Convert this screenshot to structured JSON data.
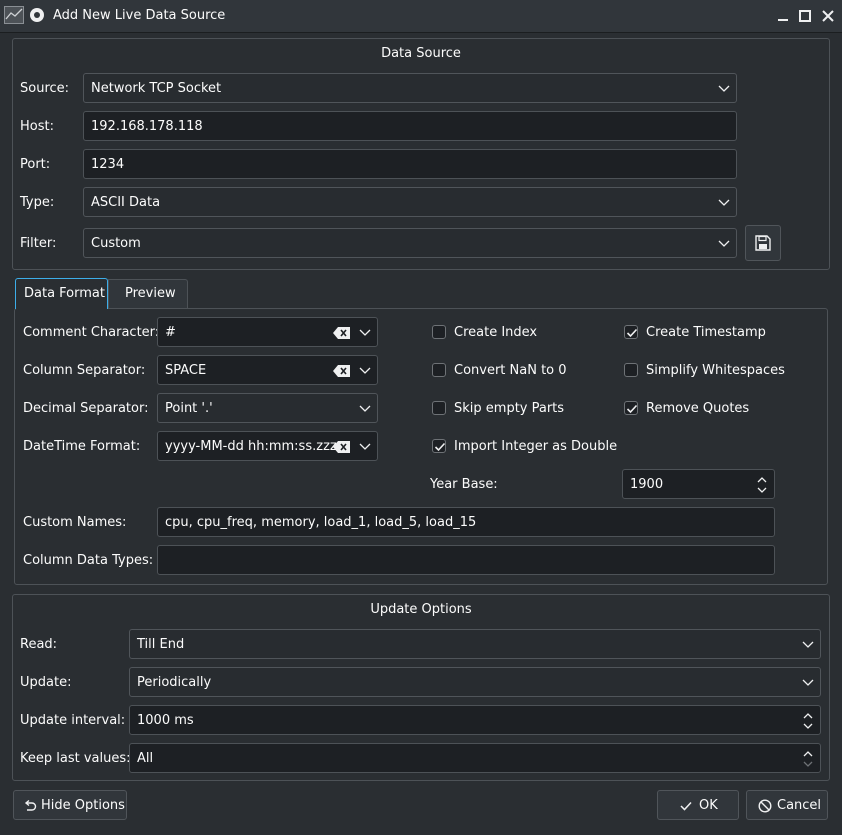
{
  "window": {
    "title": "Add New Live Data Source"
  },
  "data_source": {
    "title": "Data Source",
    "source": {
      "label": "Source:",
      "value": "Network TCP Socket"
    },
    "host": {
      "label": "Host:",
      "value": "192.168.178.118"
    },
    "port": {
      "label": "Port:",
      "value": "1234"
    },
    "type": {
      "label": "Type:",
      "value": "ASCII Data"
    },
    "filter": {
      "label": "Filter:",
      "value": "Custom"
    }
  },
  "tabs": [
    {
      "label": "Data Format",
      "active": true
    },
    {
      "label": "Preview",
      "active": false
    }
  ],
  "data_format": {
    "comment_char": {
      "label": "Comment Character:",
      "value": "#"
    },
    "column_sep": {
      "label": "Column Separator:",
      "value": "SPACE"
    },
    "decimal_sep": {
      "label": "Decimal Separator:",
      "value": "Point '.'"
    },
    "datetime_format": {
      "label": "DateTime Format:",
      "value": "yyyy-MM-dd hh:mm:ss.zzz"
    },
    "checkboxes": {
      "create_index": {
        "label": "Create Index",
        "checked": false
      },
      "create_timestamp": {
        "label": "Create Timestamp",
        "checked": true
      },
      "convert_nan": {
        "label": "Convert NaN to 0",
        "checked": false
      },
      "simplify_ws": {
        "label": "Simplify Whitespaces",
        "checked": false
      },
      "skip_empty": {
        "label": "Skip empty Parts",
        "checked": false
      },
      "remove_quotes": {
        "label": "Remove Quotes",
        "checked": true
      },
      "import_int": {
        "label": "Import Integer as Double",
        "checked": true
      }
    },
    "year_base": {
      "label": "Year Base:",
      "value": "1900"
    },
    "custom_names": {
      "label": "Custom Names:",
      "value": "cpu, cpu_freq, memory, load_1, load_5,  load_15"
    },
    "column_types": {
      "label": "Column Data Types:",
      "value": ""
    }
  },
  "update_options": {
    "title": "Update Options",
    "read": {
      "label": "Read:",
      "value": "Till End"
    },
    "update": {
      "label": "Update:",
      "value": "Periodically"
    },
    "interval": {
      "label": "Update interval:",
      "value": "1000 ms"
    },
    "keep_last": {
      "label": "Keep last values:",
      "value": "All"
    }
  },
  "buttons": {
    "hide_options": "Hide Options",
    "ok": "OK",
    "cancel": "Cancel"
  },
  "colors": {
    "accent": "#3daee9",
    "background": "#2a2e32",
    "field": "#1d2024"
  }
}
